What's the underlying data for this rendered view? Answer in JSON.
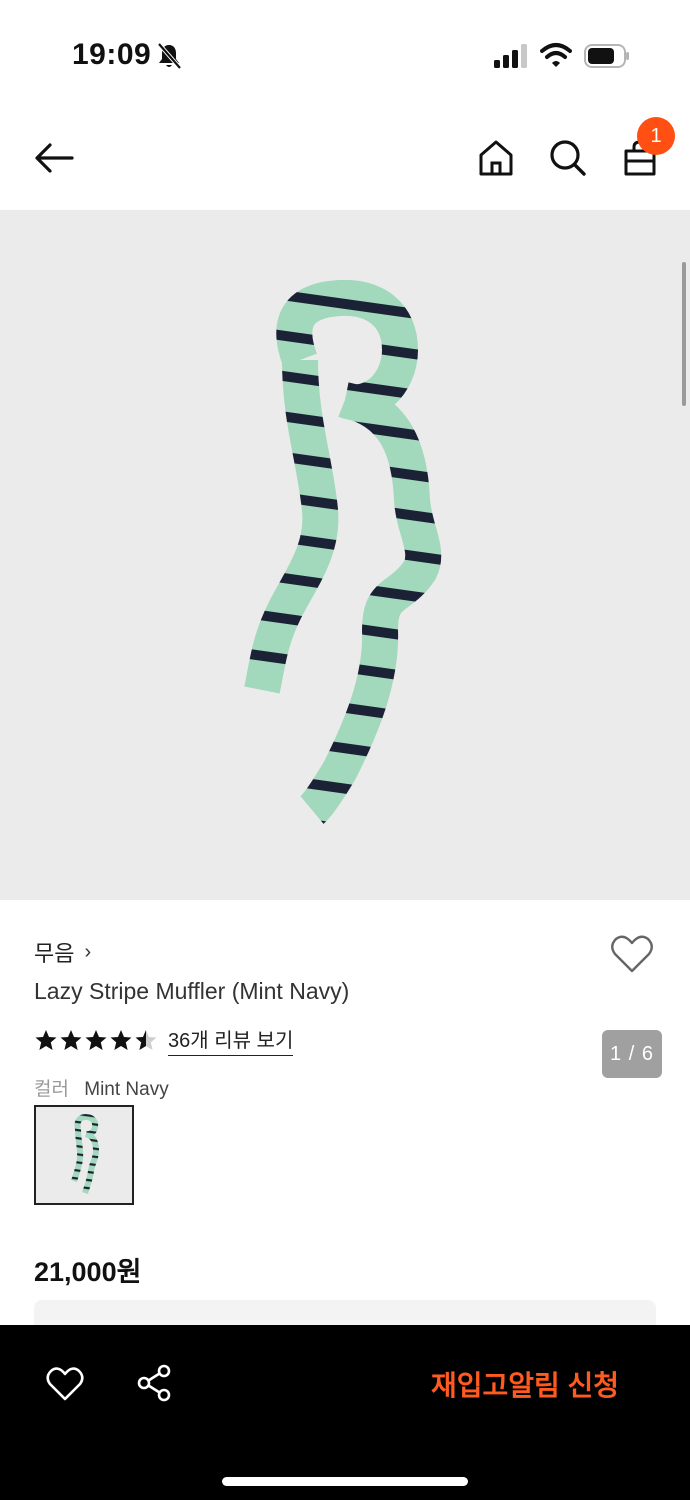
{
  "status_bar": {
    "time": "19:09"
  },
  "header": {
    "cart_count": "1"
  },
  "gallery": {
    "page_indicator": "1 / 6"
  },
  "product": {
    "brand": "무음",
    "brand_chevron": "›",
    "name": "Lazy Stripe Muffler (Mint Navy)",
    "rating": 4.5,
    "review_link": "36개 리뷰 보기",
    "color_label": "컬러",
    "color_value": "Mint Navy",
    "price": "21,000원"
  },
  "colors": {
    "accent": "#ff4f12",
    "mint": "#9fd6b9",
    "navy": "#1c2236"
  },
  "bottom_bar": {
    "restock_button": "재입고알림 신청"
  },
  "icons": [
    "back-arrow-icon",
    "home-icon",
    "search-icon",
    "shopping-bag-icon",
    "heart-icon",
    "share-icon",
    "star-icon",
    "bell-off-icon",
    "signal-icon",
    "wifi-icon",
    "battery-icon"
  ]
}
